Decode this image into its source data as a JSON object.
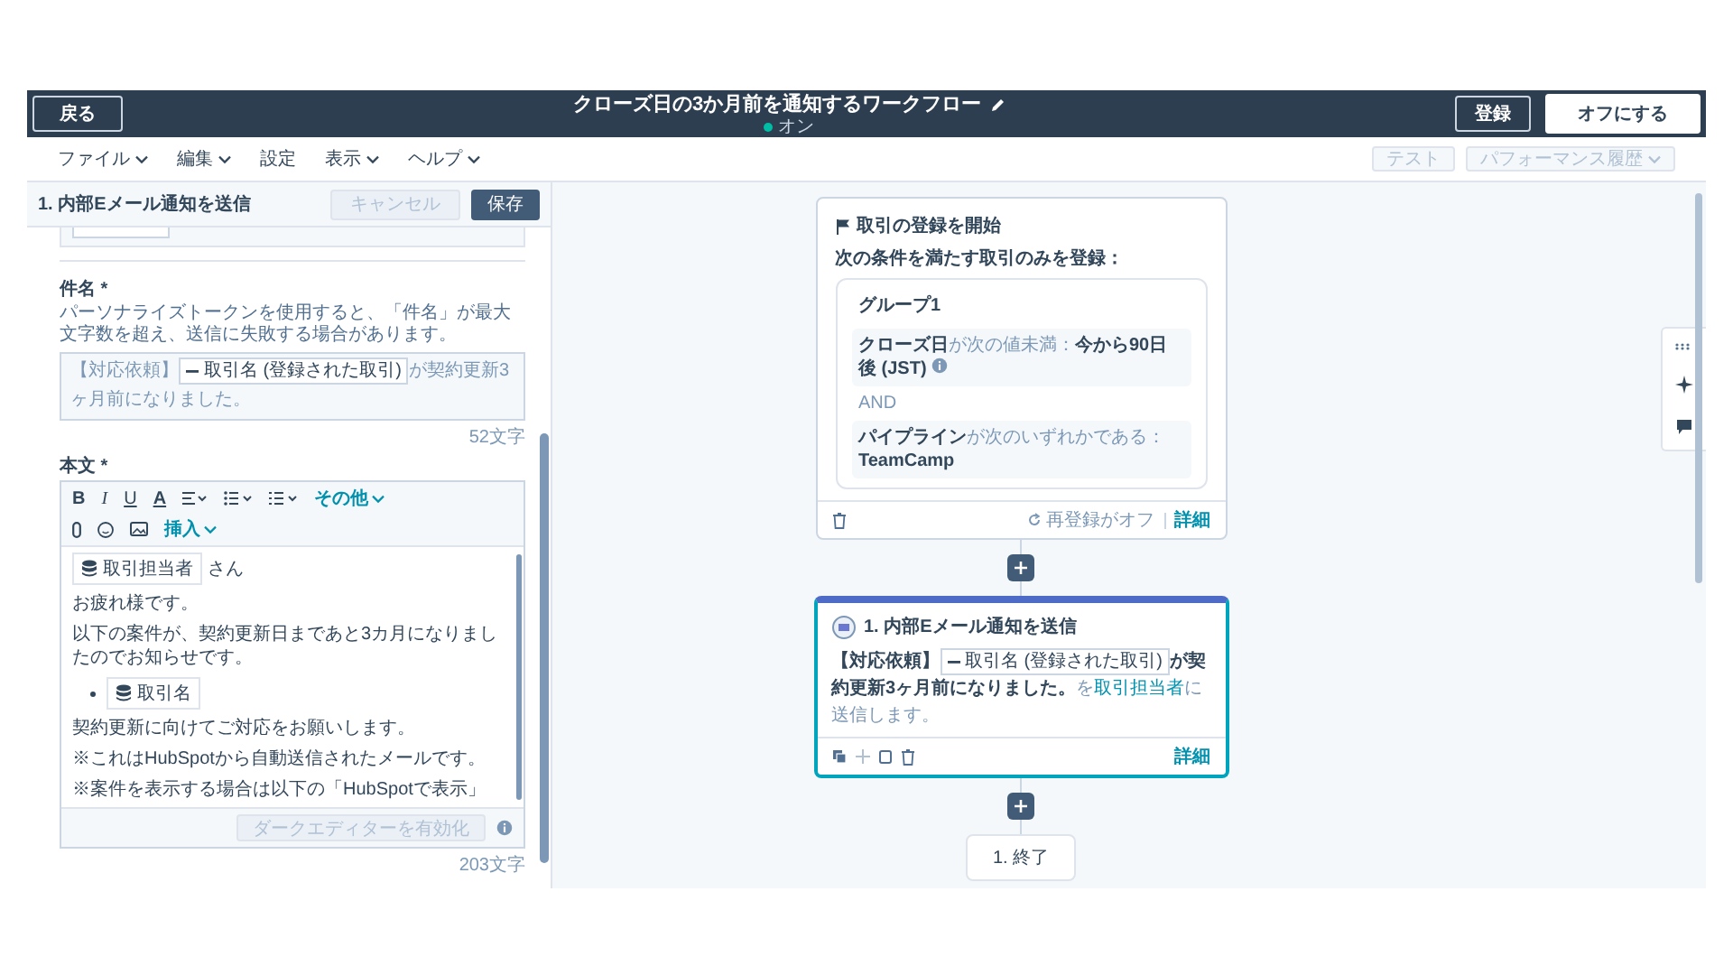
{
  "header": {
    "back_button": "戻る",
    "title": "クローズ日の3か月前を通知するワークフロー",
    "status": {
      "label": "オン",
      "on": true
    },
    "register_button": "登録",
    "turn_off_button": "オフにする"
  },
  "menu": [
    {
      "label": "ファイル",
      "dropdown": true
    },
    {
      "label": "編集",
      "dropdown": true
    },
    {
      "label": "設定",
      "dropdown": false
    },
    {
      "label": "表示",
      "dropdown": true
    },
    {
      "label": "ヘルプ",
      "dropdown": true
    }
  ],
  "toolbar_buttons": [
    {
      "label": "テスト",
      "disabled": true,
      "dropdown": false
    },
    {
      "label": "パフォーマンス履歴",
      "disabled": true,
      "dropdown": true
    }
  ],
  "panel": {
    "title": "1. 内部Eメール通知を送信",
    "cancel_button": {
      "label": "キャンセル",
      "disabled": true
    },
    "save_button": {
      "label": "保存",
      "disabled": false
    },
    "subject": {
      "label": "件名 *",
      "help": "パーソナライズトークンを使用すると、「件名」が最大文字数を超え、送信に失敗する場合があります。",
      "parts": [
        {
          "kind": "text",
          "text": "【対応依頼】"
        },
        {
          "kind": "token",
          "text": "取引名 (登録された取引)"
        },
        {
          "kind": "text",
          "text": "が契約更新3ヶ月前になりました。"
        }
      ],
      "count": "52文字"
    },
    "body": {
      "label": "本文 *",
      "toolbar": {
        "bold": "B",
        "italic": "I",
        "underline": "U",
        "text_color": "A",
        "more": "その他",
        "insert": "挿入"
      },
      "content": [
        {
          "kind": "token_line",
          "token": "取引担当者",
          "suffix": "さん"
        },
        {
          "kind": "paragraph",
          "text": "お疲れ様です。"
        },
        {
          "kind": "paragraph",
          "text": "以下の案件が、契約更新日まであと3カ月になりましたのでお知らせです。"
        },
        {
          "kind": "bullet_token",
          "token": "取引名"
        },
        {
          "kind": "paragraph",
          "text": "契約更新に向けてご対応をお願いします。"
        },
        {
          "kind": "paragraph",
          "text": "※これはHubSpotから自動送信されたメールです。"
        },
        {
          "kind": "paragraph",
          "text": "※案件を表示する場合は以下の「HubSpotで表示」"
        }
      ],
      "dark_editor_button": {
        "label": "ダークエディターを有効化",
        "disabled": true
      },
      "count": "203文字"
    }
  },
  "workflow": {
    "trigger": {
      "title": "取引の登録を開始",
      "subtitle": "次の条件を満たす取引のみを登録：",
      "group": {
        "title": "グループ1",
        "joiner": "AND",
        "conditions": [
          {
            "property": "クローズ日",
            "operator": "が次の値未満：",
            "value": "今から90日後 (JST)",
            "info": true
          },
          {
            "property": "パイプライン",
            "operator": "が次のいずれかである：",
            "value": "TeamCamp",
            "info": false
          }
        ]
      },
      "reenroll": "再登録がオフ",
      "details": "詳細"
    },
    "action": {
      "title": "1. 内部Eメール通知を送信",
      "selected": true,
      "parts": [
        {
          "kind": "text",
          "text": "【対応依頼】"
        },
        {
          "kind": "token",
          "text": "取引名 (登録された取引)"
        },
        {
          "kind": "text",
          "text": "が契約更新3ヶ月前になりました。"
        },
        {
          "kind": "muted",
          "text": "を"
        },
        {
          "kind": "link",
          "text": "取引担当者"
        },
        {
          "kind": "muted",
          "text": "に送信します。"
        }
      ],
      "details": "詳細"
    },
    "end": {
      "label": "1. 終了"
    }
  }
}
